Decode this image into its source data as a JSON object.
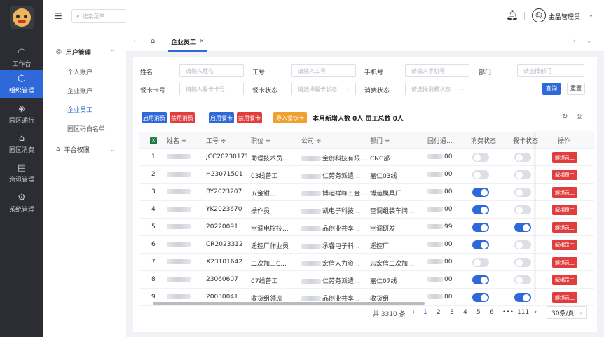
{
  "sidebar": {
    "items": [
      {
        "label": "工作台",
        "icon": "dashboard-gauge-icon",
        "active": false
      },
      {
        "label": "组织管理",
        "icon": "cube-icon",
        "active": true
      },
      {
        "label": "园区通行",
        "icon": "diamond-icon",
        "active": false
      },
      {
        "label": "园区消费",
        "icon": "bag-icon",
        "active": false
      },
      {
        "label": "资讯管理",
        "icon": "document-icon",
        "active": false
      },
      {
        "label": "系统管理",
        "icon": "gear-icon",
        "active": false
      }
    ]
  },
  "submenu": {
    "search_placeholder": "搜索菜单",
    "group1": "用户管理",
    "items": [
      "个人账户",
      "企业账户",
      "企业员工",
      "园区码白名单"
    ],
    "group2": "平台权限"
  },
  "topbar": {
    "user": "金品管理员"
  },
  "tabs": {
    "active": "企业员工",
    "close": "×"
  },
  "filters": {
    "name_label": "姓名",
    "name_ph": "请输入姓名",
    "no_label": "工号",
    "no_ph": "请输入工号",
    "phone_label": "手机号",
    "phone_ph": "请输入手机号",
    "dept_label": "部门",
    "dept_ph": "请选择部门",
    "card_label": "餐卡卡号",
    "card_ph": "请输入餐卡卡号",
    "cardstatus_label": "餐卡状态",
    "cardstatus_ph": "请选择餐卡状态",
    "consume_label": "消费状态",
    "consume_ph": "请选择消费状态",
    "query": "查询",
    "reset": "重置"
  },
  "actions": {
    "enable_consume": "启用消费",
    "disable_consume": "禁用消费",
    "enable_card": "启用餐卡",
    "disable_card": "禁用餐卡",
    "import_card": "导入餐饮卡",
    "summary": "本月新增人数 0人 员工总数 0人",
    "colors": {
      "blue": "#2f68d8",
      "red": "#e03e3e",
      "orange": "#f0a030"
    }
  },
  "table": {
    "headers": {
      "name": "姓名 ≑",
      "no": "工号 ≑",
      "pos": "职位 ≑",
      "company": "公司 ≑",
      "dept": "部门 ≑",
      "pay": "园付通...",
      "consume": "消费状态",
      "card": "餐卡状态",
      "op": "操作"
    },
    "rows": [
      {
        "idx": "1",
        "no": "JCC20230171",
        "pos": "助理技术员...",
        "company": "金创科技有限...",
        "dept": "CNC部",
        "pay": "00",
        "consume": false,
        "card": false
      },
      {
        "idx": "2",
        "no": "H23071501",
        "pos": "03线普工",
        "company": "仁劳务派遣...",
        "dept": "嘉仁03线",
        "pay": "00",
        "consume": false,
        "card": false
      },
      {
        "idx": "3",
        "no": "BY2023207",
        "pos": "五金钳工",
        "company": "博运祥峰五金...",
        "dept": "博运模具厂",
        "pay": "00",
        "consume": true,
        "card": false
      },
      {
        "idx": "4",
        "no": "YK2023670",
        "pos": "操作员",
        "company": "凯电子科技...",
        "dept": "空调组装车间...",
        "pay": "00",
        "consume": true,
        "card": false
      },
      {
        "idx": "5",
        "no": "20220091",
        "pos": "空调电控技...",
        "company": "品创业共享...",
        "dept": "空调研发",
        "pay": "99",
        "consume": true,
        "card": true
      },
      {
        "idx": "6",
        "no": "CR2023312",
        "pos": "遥控厂作业员",
        "company": "承睿电子科...",
        "dept": "遥控厂",
        "pay": "00",
        "consume": true,
        "card": false
      },
      {
        "idx": "7",
        "no": "X23101642",
        "pos": "二次加工C...",
        "company": "宏信人力资...",
        "dept": "志宏信二次加...",
        "pay": "00",
        "consume": false,
        "card": false
      },
      {
        "idx": "8",
        "no": "23060607",
        "pos": "07线普工",
        "company": "仁劳务派遣...",
        "dept": "嘉仁07线",
        "pay": "00",
        "consume": true,
        "card": false
      },
      {
        "idx": "9",
        "no": "20030041",
        "pos": "收货组领班",
        "company": "品创业共享...",
        "dept": "收货组",
        "pay": "00",
        "consume": true,
        "card": true
      }
    ],
    "op_label": "解绑员工"
  },
  "pagination": {
    "total": "共 3310 条",
    "pages": [
      "1",
      "2",
      "3",
      "4",
      "5",
      "6",
      "•••",
      "111"
    ],
    "current": "1",
    "size": "30条/页"
  }
}
